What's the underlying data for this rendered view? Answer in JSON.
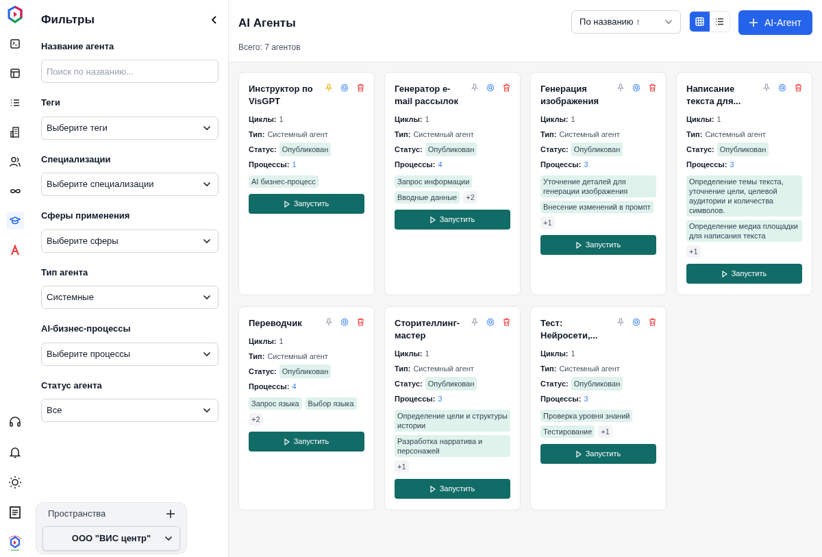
{
  "rail": {
    "top": [
      {
        "kind": "logo",
        "selected": false
      },
      {
        "kind": "terminal",
        "selected": false
      },
      {
        "kind": "table",
        "selected": false
      },
      {
        "kind": "list",
        "selected": false
      },
      {
        "kind": "building",
        "selected": false
      },
      {
        "kind": "users",
        "selected": false
      },
      {
        "kind": "infinity",
        "selected": false
      },
      {
        "kind": "cap",
        "selected": true
      },
      {
        "kind": "a-logo",
        "selected": false
      }
    ],
    "bottom": [
      {
        "kind": "headset",
        "selected": false
      },
      {
        "kind": "bell",
        "selected": false
      },
      {
        "kind": "sun",
        "selected": false
      },
      {
        "kind": "notes",
        "selected": false
      },
      {
        "kind": "app-logo",
        "selected": false
      }
    ]
  },
  "filters": {
    "title": "Фильтры",
    "fields": [
      {
        "label": "Название агента",
        "kind": "input",
        "placeholder": "Поиск по названию..."
      },
      {
        "label": "Теги",
        "kind": "select",
        "value": "Выберите теги"
      },
      {
        "label": "Специализации",
        "kind": "select",
        "value": "Выберите специализации"
      },
      {
        "label": "Сферы применения",
        "kind": "select",
        "value": "Выберите сферы"
      },
      {
        "label": "Тип агента",
        "kind": "select",
        "value": "Системные"
      },
      {
        "label": "AI-бизнес-процессы",
        "kind": "select",
        "value": "Выберите процессы"
      },
      {
        "label": "Статус агента",
        "kind": "select",
        "value": "Все"
      }
    ]
  },
  "spaces": {
    "title": "Пространства",
    "current": "ООО \"ВИС центр\""
  },
  "header": {
    "title": "AI Агенты",
    "subtitle": "Всего: 7 агентов",
    "sort": "По названию ↑",
    "views": [
      {
        "kind": "grid",
        "selected": true
      },
      {
        "kind": "list",
        "selected": false
      }
    ],
    "add_button": "AI-Агент"
  },
  "cards": [
    {
      "title": "Инструктор по VisGPT",
      "pinned": true,
      "cycles_label": "Циклы:",
      "cycles": "1",
      "type_label": "Тип:",
      "type": "Системный агент",
      "status_label": "Статус:",
      "status": "Опубликован",
      "processes_label": "Процессы:",
      "processes": "1",
      "process_tags": [
        "AI бизнес-процесс"
      ],
      "run": "Запустить"
    },
    {
      "title": "Генератор e-mail рассылок",
      "pinned": false,
      "cycles_label": "Циклы:",
      "cycles": "1",
      "type_label": "Тип:",
      "type": "Системный агент",
      "status_label": "Статус:",
      "status": "Опубликован",
      "processes_label": "Процессы:",
      "processes": "4",
      "process_tags": [
        "Запрос информации",
        "Вводные данные"
      ],
      "more": "+2",
      "run": "Запустить"
    },
    {
      "title": "Генерация изображения",
      "pinned": false,
      "cycles_label": "Циклы:",
      "cycles": "1",
      "type_label": "Тип:",
      "type": "Системный агент",
      "status_label": "Статус:",
      "status": "Опубликован",
      "processes_label": "Процессы:",
      "processes": "3",
      "process_tags": [
        "Уточнение деталей для генерации изображения",
        "Внесение изменений в промпт"
      ],
      "more": "+1",
      "run": "Запустить"
    },
    {
      "title": "Написание текста для...",
      "pinned": false,
      "cycles_label": "Циклы:",
      "cycles": "1",
      "type_label": "Тип:",
      "type": "Системный агент",
      "status_label": "Статус:",
      "status": "Опубликован",
      "processes_label": "Процессы:",
      "processes": "3",
      "process_tags": [
        "Определение темы текста, уточнение цели, целевой аудитории и количества символов.",
        "Определение медиа площадки для написания текста"
      ],
      "more": "+1",
      "run": "Запустить"
    },
    {
      "title": "Переводчик",
      "pinned": false,
      "cycles_label": "Циклы:",
      "cycles": "1",
      "type_label": "Тип:",
      "type": "Системный агент",
      "status_label": "Статус:",
      "status": "Опубликован",
      "processes_label": "Процессы:",
      "processes": "4",
      "process_tags": [
        "Запрос языка",
        "Выбор языка"
      ],
      "more": "+2",
      "run": "Запустить"
    },
    {
      "title": "Сторителлинг-мастер",
      "pinned": false,
      "cycles_label": "Циклы:",
      "cycles": "1",
      "type_label": "Тип:",
      "type": "Системный агент",
      "status_label": "Статус:",
      "status": "Опубликован",
      "processes_label": "Процессы:",
      "processes": "3",
      "process_tags": [
        "Определение цели и структуры истории",
        "Разработка нарратива и персонажей"
      ],
      "more": "+1",
      "run": "Запустить"
    },
    {
      "title": "Тест: Нейросети,...",
      "pinned": false,
      "cycles_label": "Циклы:",
      "cycles": "1",
      "type_label": "Тип:",
      "type": "Системный агент",
      "status_label": "Статус:",
      "status": "Опубликован",
      "processes_label": "Процессы:",
      "processes": "3",
      "process_tags": [
        "Проверка уровня знаний",
        "Тестирование"
      ],
      "more": "+1",
      "run": "Запустить"
    }
  ]
}
